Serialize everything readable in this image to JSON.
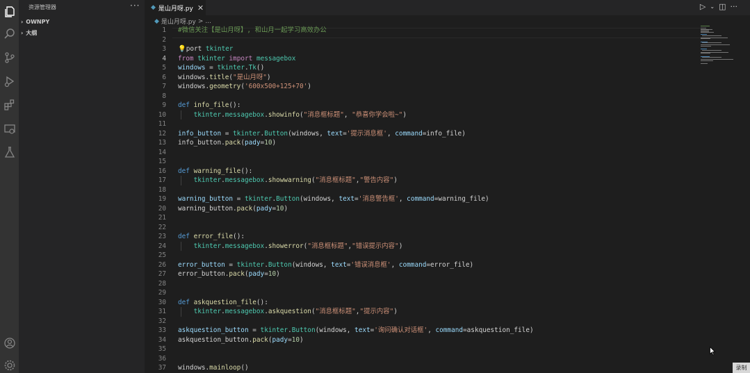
{
  "sidebar": {
    "title": "资源管理器",
    "more": "···",
    "sections": [
      {
        "label": "OWNPY"
      },
      {
        "label": "大纲"
      }
    ]
  },
  "tab": {
    "label": "是山月呀.py",
    "close": "✕"
  },
  "breadcrumb": {
    "file": "是山月呀.py",
    "sep": ">",
    "more": "..."
  },
  "record_badge": "录制",
  "icons": {
    "activity": [
      "explorer-icon",
      "search-icon",
      "source-control-icon",
      "run-debug-icon",
      "extensions-icon",
      "remote-explorer-icon",
      "testing-icon"
    ],
    "bottom": [
      "account-icon",
      "settings-gear-icon"
    ]
  },
  "code": {
    "current_line": 4,
    "lines": [
      {
        "n": "1",
        "t": "#微信关注【是山月呀】, 和山月一起学习高效办公"
      },
      {
        "n": "2",
        "t": ""
      },
      {
        "n": "3",
        "t": "💡port tkinter"
      },
      {
        "n": "4",
        "t": "from tkinter import messagebox"
      },
      {
        "n": "5",
        "t": "windows = tkinter.Tk()"
      },
      {
        "n": "6",
        "t": "windows.title(\"是山月呀\")"
      },
      {
        "n": "7",
        "t": "windows.geometry('600x500+125+70')"
      },
      {
        "n": "8",
        "t": ""
      },
      {
        "n": "9",
        "t": "def info_file():"
      },
      {
        "n": "10",
        "t": "    tkinter.messagebox.showinfo(\"消息框标题\", \"恭喜你学会啦~\")"
      },
      {
        "n": "11",
        "t": ""
      },
      {
        "n": "12",
        "t": "info_button = tkinter.Button(windows, text='提示消息框', command=info_file)"
      },
      {
        "n": "13",
        "t": "info_button.pack(pady=10)"
      },
      {
        "n": "14",
        "t": ""
      },
      {
        "n": "15",
        "t": ""
      },
      {
        "n": "16",
        "t": "def warning_file():"
      },
      {
        "n": "17",
        "t": "    tkinter.messagebox.showwarning(\"消息框标题\",\"警告内容\")"
      },
      {
        "n": "18",
        "t": ""
      },
      {
        "n": "19",
        "t": "warning_button = tkinter.Button(windows, text='消息警告框', command=warning_file)"
      },
      {
        "n": "20",
        "t": "warning_button.pack(pady=10)"
      },
      {
        "n": "21",
        "t": ""
      },
      {
        "n": "22",
        "t": ""
      },
      {
        "n": "23",
        "t": "def error_file():"
      },
      {
        "n": "24",
        "t": "    tkinter.messagebox.showerror(\"消息框标题\",\"错误提示内容\")"
      },
      {
        "n": "25",
        "t": ""
      },
      {
        "n": "26",
        "t": "error_button = tkinter.Button(windows, text='错误消息框', command=error_file)"
      },
      {
        "n": "27",
        "t": "error_button.pack(pady=10)"
      },
      {
        "n": "28",
        "t": ""
      },
      {
        "n": "29",
        "t": ""
      },
      {
        "n": "30",
        "t": "def askquestion_file():"
      },
      {
        "n": "31",
        "t": "    tkinter.messagebox.askquestion(\"消息框标题\",\"提示内容\")"
      },
      {
        "n": "32",
        "t": ""
      },
      {
        "n": "33",
        "t": "askquestion_button = tkinter.Button(windows, text='询问确认对话框', command=askquestion_file)"
      },
      {
        "n": "34",
        "t": "askquestion_button.pack(pady=10)"
      },
      {
        "n": "35",
        "t": ""
      },
      {
        "n": "36",
        "t": ""
      },
      {
        "n": "37",
        "t": "windows.mainloop()"
      }
    ]
  },
  "colors": {
    "activity_bar": "#333333",
    "sidebar": "#252526",
    "editor_bg": "#1e1e1e",
    "keyword": "#569cd6",
    "function": "#dcdcaa",
    "string": "#ce9178",
    "number": "#b5cea8",
    "class": "#4ec9b0",
    "variable": "#9cdcfe",
    "comment": "#6a9955"
  }
}
